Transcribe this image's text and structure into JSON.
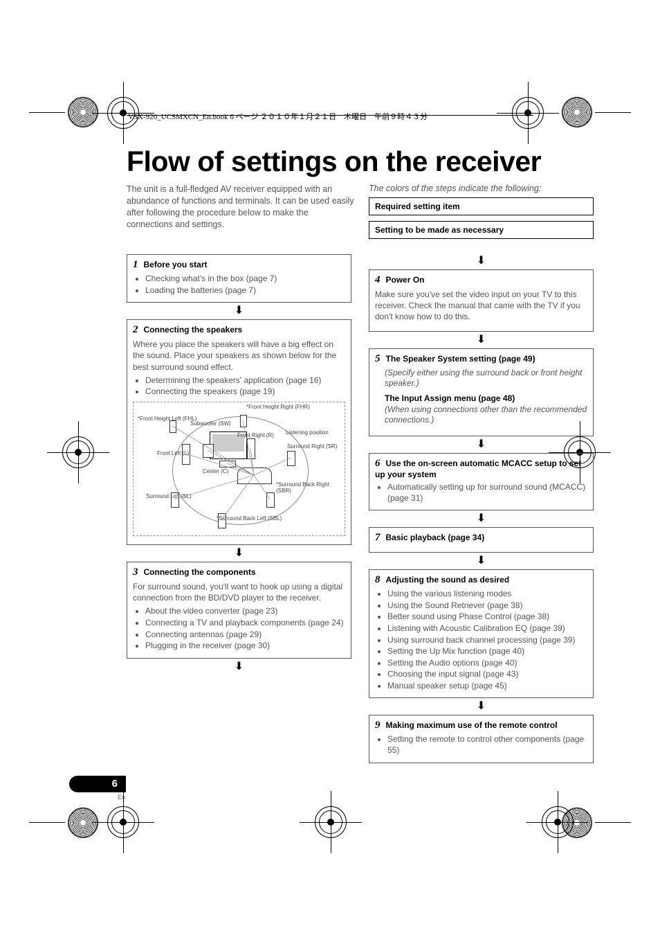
{
  "header": "VSX-920_UCSMXCN_En.book  6 ページ  ２０１０年１月２１日　木曜日　午前９時４３分",
  "title": "Flow of settings on the receiver",
  "intro": "The unit is a full-fledged AV receiver equipped with an abundance of functions and terminals. It can be used easily after following the procedure below to make the connections and settings.",
  "legend_intro": "The colors of the steps indicate the following:",
  "legend_required": "Required setting item",
  "legend_optional": "Setting to be made as necessary",
  "steps": {
    "s1": {
      "num": "1",
      "title": "Before you start",
      "bullets": [
        "Checking what's in the box (page 7)",
        "Loading the batteries (page 7)"
      ]
    },
    "s2": {
      "num": "2",
      "title": "Connecting the speakers",
      "para": "Where you place the speakers will have a big effect on the sound. Place your speakers as shown below for the best surround sound effect.",
      "bullets": [
        "Determining the speakers' application (page 16)",
        "Connecting the speakers (page 19)"
      ],
      "diagram": {
        "fhl": "*Front Height Left (FHL)",
        "fhr": "*Front Height Right (FHR)",
        "sw": "Subwoofer (SW)",
        "fl": "Front Left (L)",
        "fr": "Front Right (R)",
        "c": "Center (C)",
        "listen": "Listening position",
        "sr": "Surround Right (SR)",
        "sl": "Surround Left (SL)",
        "sbr": "*Surround Back Right (SBR)",
        "sbl": "*Surround Back Left (SBL)"
      }
    },
    "s3": {
      "num": "3",
      "title": "Connecting the components",
      "para": "For surround sound, you'll want to hook up using a digital connection from the BD/DVD player to the receiver.",
      "bullets": [
        "About the video converter (page 23)",
        "Connecting a TV and playback components (page 24)",
        "Connecting antennas (page 29)",
        "Plugging in the receiver (page 30)"
      ]
    },
    "s4": {
      "num": "4",
      "title": "Power On",
      "para": "Make sure you've set the video input on your TV to this receiver. Check the manual that came with the TV if you don't know how to do this."
    },
    "s5": {
      "num": "5",
      "title": "The Speaker System setting (page 49)",
      "sub1": "(Specify either using the surround back or front height speaker.)",
      "title2": "The Input Assign menu (page 48)",
      "sub2": "(When using connections other than the recommended connections.)"
    },
    "s6": {
      "num": "6",
      "title": "Use the on-screen automatic MCACC setup to set up your system",
      "bullets": [
        "Automatically setting up for surround sound (MCACC) (page 31)"
      ]
    },
    "s7": {
      "num": "7",
      "title": "Basic playback (page 34)"
    },
    "s8": {
      "num": "8",
      "title": "Adjusting the sound as desired",
      "bullets": [
        "Using the various listening modes",
        "Using the Sound Retriever (page 38)",
        "Better sound using Phase Control (page 38)",
        "Listening with Acoustic Calibration EQ (page 39)",
        "Using surround back channel processing (page 39)",
        "Setting the Up Mix function (page 40)",
        "Setting the Audio options (page 40)",
        "Choosing the input signal (page 43)",
        "Manual speaker setup (page 45)"
      ]
    },
    "s9": {
      "num": "9",
      "title": "Making maximum use of the remote control",
      "bullets": [
        "Setting the remote to control other components (page 55)"
      ]
    }
  },
  "page_num": "6",
  "page_lang": "En"
}
